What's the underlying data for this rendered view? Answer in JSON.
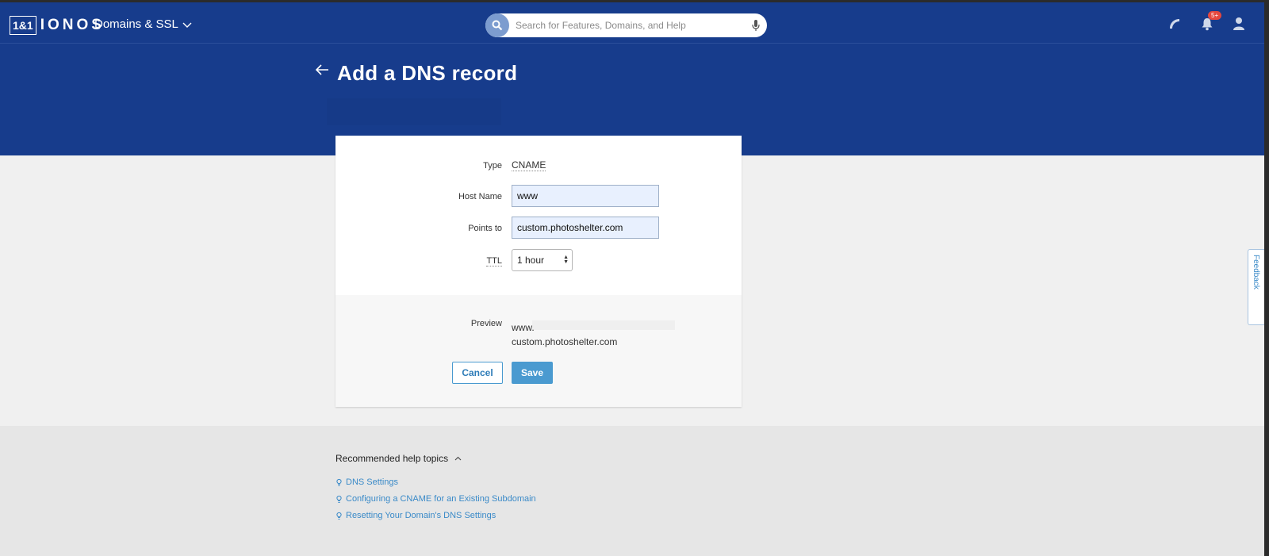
{
  "header": {
    "logo_mark": "1&1",
    "logo_word": "IONOS",
    "product_switch": "Domains & SSL",
    "search_placeholder": "Search for Features, Domains, and Help",
    "notification_badge": "5+"
  },
  "page": {
    "title": "Add a DNS record"
  },
  "form": {
    "type_label": "Type",
    "type_value": "CNAME",
    "host_label": "Host Name",
    "host_value": "www",
    "points_label": "Points to",
    "points_value": "custom.photoshelter.com",
    "ttl_label": "TTL",
    "ttl_value": "1 hour",
    "preview_label": "Preview",
    "preview_line1": "www.",
    "preview_line2": "custom.photoshelter.com",
    "cancel_label": "Cancel",
    "save_label": "Save"
  },
  "help": {
    "heading": "Recommended help topics",
    "links": [
      "DNS Settings",
      "Configuring a CNAME for an Existing Subdomain",
      "Resetting Your Domain's DNS Settings"
    ]
  },
  "feedback": {
    "label": "Feedback"
  },
  "colors": {
    "brand_blue": "#173c8c",
    "accent": "#4a9ad0"
  }
}
